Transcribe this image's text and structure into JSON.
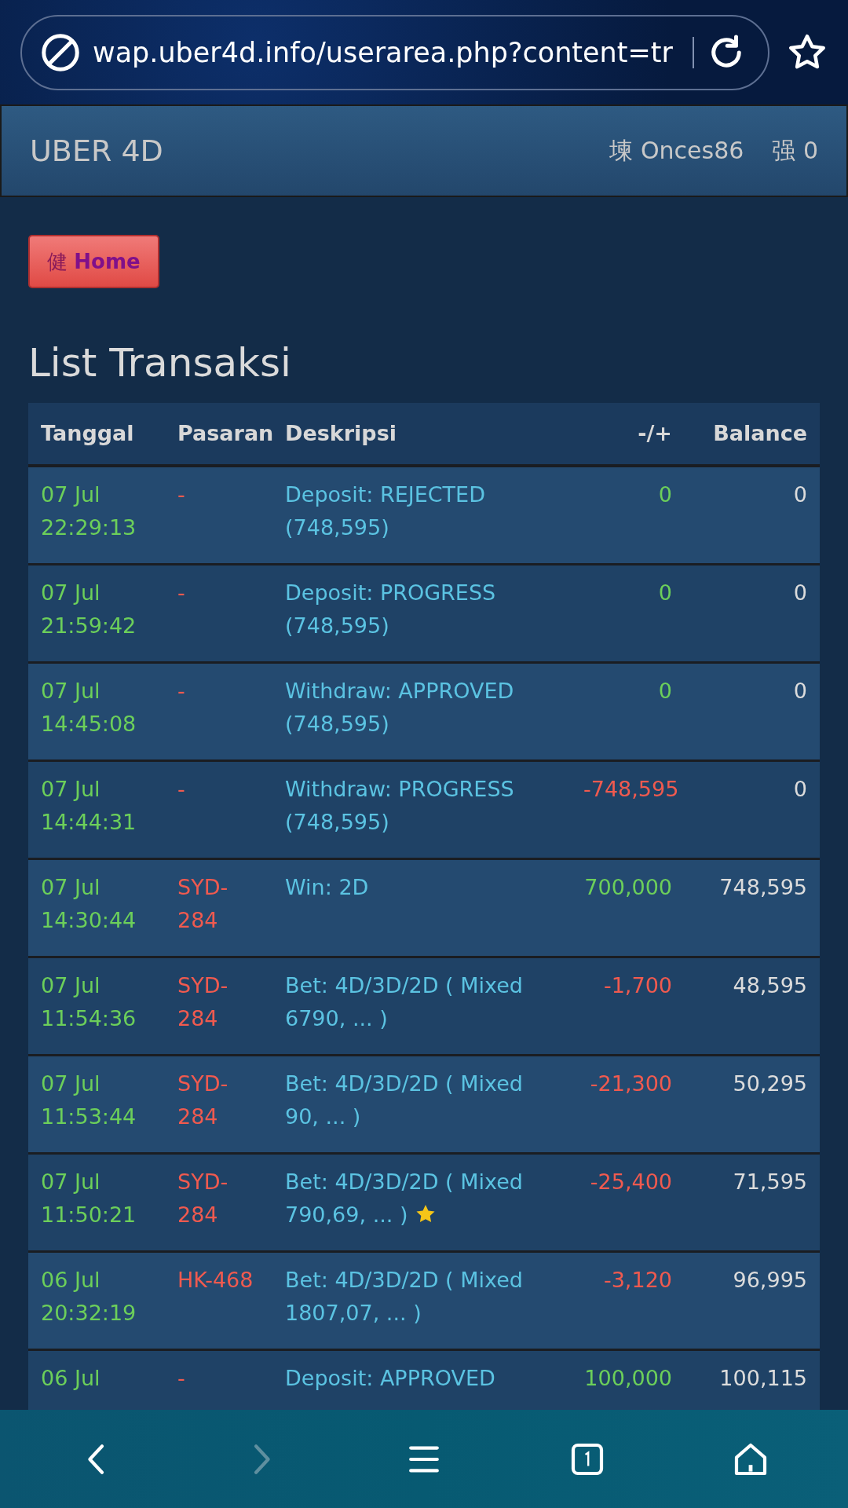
{
  "browser": {
    "url": "wap.uber4d.info/userarea.php?content=tr"
  },
  "navbar": {
    "brand": "UBER 4D",
    "user_glyph": "堜",
    "username": "Onces86",
    "balance_glyph": "强",
    "balance": "0"
  },
  "home_button": {
    "glyph": "健",
    "label": "Home"
  },
  "title": "List Transaksi",
  "table": {
    "columns": [
      "Tanggal",
      "Pasaran",
      "Deskripsi",
      "-/+",
      "Balance"
    ],
    "rows": [
      {
        "date": "07 Jul",
        "time": "22:29:13",
        "market": "-",
        "description": "Deposit: REJECTED (748,595)",
        "amount": "0",
        "kind": "credit",
        "balance": "0",
        "starred": false
      },
      {
        "date": "07 Jul",
        "time": "21:59:42",
        "market": "-",
        "description": "Deposit: PROGRESS (748,595)",
        "amount": "0",
        "kind": "credit",
        "balance": "0",
        "starred": false
      },
      {
        "date": "07 Jul",
        "time": "14:45:08",
        "market": "-",
        "description": "Withdraw: APPROVED (748,595)",
        "amount": "0",
        "kind": "credit",
        "balance": "0",
        "starred": false
      },
      {
        "date": "07 Jul",
        "time": "14:44:31",
        "market": "-",
        "description": "Withdraw: PROGRESS (748,595)",
        "amount": "-748,595",
        "kind": "debit",
        "balance": "0",
        "starred": false
      },
      {
        "date": "07 Jul",
        "time": "14:30:44",
        "market": "SYD-284",
        "description": "Win: 2D",
        "amount": "700,000",
        "kind": "credit",
        "balance": "748,595",
        "starred": false
      },
      {
        "date": "07 Jul",
        "time": "11:54:36",
        "market": "SYD-284",
        "description": "Bet: 4D/3D/2D ( Mixed 6790, ... )",
        "amount": "-1,700",
        "kind": "debit",
        "balance": "48,595",
        "starred": false
      },
      {
        "date": "07 Jul",
        "time": "11:53:44",
        "market": "SYD-284",
        "description": "Bet: 4D/3D/2D ( Mixed 90, ... )",
        "amount": "-21,300",
        "kind": "debit",
        "balance": "50,295",
        "starred": false
      },
      {
        "date": "07 Jul",
        "time": "11:50:21",
        "market": "SYD-284",
        "description": "Bet: 4D/3D/2D ( Mixed 790,69, ... )",
        "amount": "-25,400",
        "kind": "debit",
        "balance": "71,595",
        "starred": true
      },
      {
        "date": "06 Jul",
        "time": "20:32:19",
        "market": "HK-468",
        "description": "Bet: 4D/3D/2D ( Mixed 1807,07, ... )",
        "amount": "-3,120",
        "kind": "debit",
        "balance": "96,995",
        "starred": false
      },
      {
        "date": "06 Jul",
        "market": "-",
        "description": "Deposit: APPROVED",
        "amount": "100,000",
        "kind": "credit",
        "balance": "100,115",
        "starred": false
      }
    ]
  }
}
